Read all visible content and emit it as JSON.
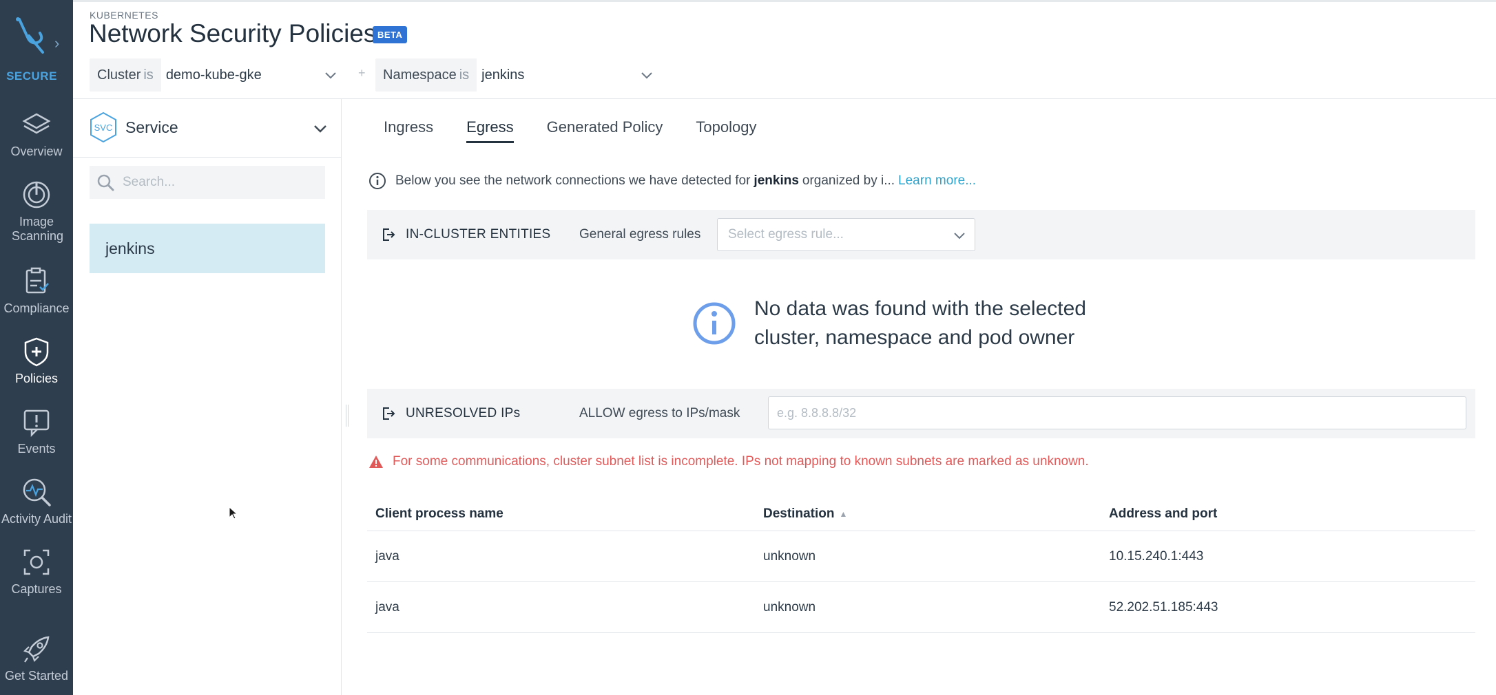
{
  "sidebar": {
    "brand": "SECURE",
    "items": [
      {
        "label": "Overview",
        "icon": "overview-icon"
      },
      {
        "label": "Image Scanning",
        "icon": "image-scanning-icon"
      },
      {
        "label": "Compliance",
        "icon": "compliance-icon"
      },
      {
        "label": "Policies",
        "icon": "policies-icon"
      },
      {
        "label": "Events",
        "icon": "events-icon"
      },
      {
        "label": "Activity Audit",
        "icon": "activity-audit-icon"
      },
      {
        "label": "Captures",
        "icon": "captures-icon"
      },
      {
        "label": "Get Started",
        "icon": "rocket-icon"
      }
    ],
    "active": "Policies",
    "colors": {
      "background": "#2f3e4e",
      "brand": "#4aa3df"
    }
  },
  "header": {
    "kicker": "KUBERNETES",
    "title": "Network Security Policies",
    "badge": "BETA",
    "filters": [
      {
        "label": "Cluster",
        "op": "is",
        "value": "demo-kube-gke"
      },
      {
        "label": "Namespace",
        "op": "is",
        "value": "jenkins"
      }
    ],
    "filter_separator": "+"
  },
  "left_panel": {
    "type_badge": "SVC",
    "type_label": "Service",
    "search_placeholder": "Search...",
    "items": [
      "jenkins"
    ]
  },
  "tabs": {
    "items": [
      "Ingress",
      "Egress",
      "Generated Policy",
      "Topology"
    ],
    "active": "Egress"
  },
  "info": {
    "text_before": "Below you see the network connections we have detected for",
    "bold": "jenkins",
    "text_after": "organized by i...",
    "link": "Learn more..."
  },
  "in_cluster": {
    "title": "IN-CLUSTER ENTITIES",
    "rule_label": "General egress rules",
    "select_placeholder": "Select egress rule..."
  },
  "no_data": {
    "line1": "No data was found with the selected",
    "line2": "cluster, namespace and pod owner"
  },
  "unresolved": {
    "title": "UNRESOLVED IPs",
    "rule_label": "ALLOW egress to IPs/mask",
    "input_placeholder": "e.g. 8.8.8.8/32"
  },
  "warning": "For some communications, cluster subnet list is incomplete. IPs not mapping to known subnets are marked as unknown.",
  "table": {
    "columns": [
      "Client process name",
      "Destination",
      "Address and port"
    ],
    "sorted_column": "Destination",
    "rows": [
      [
        "java",
        "unknown",
        "10.15.240.1:443"
      ],
      [
        "java",
        "unknown",
        "52.202.51.185:443"
      ]
    ]
  },
  "colors": {
    "accent": "#2f74d4",
    "link": "#2fa4cc",
    "warning": "#e05a5a",
    "selected_row": "#d4ebf4"
  }
}
